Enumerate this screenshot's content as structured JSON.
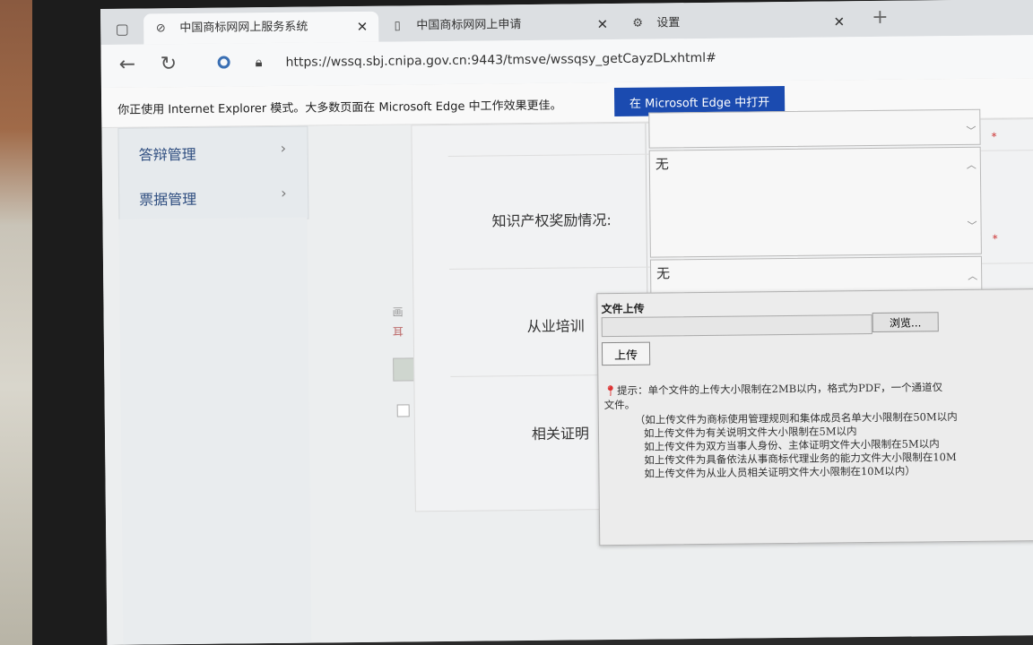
{
  "browser": {
    "tabs": [
      {
        "title": "中国商标网网上服务系统",
        "active": true
      },
      {
        "title": "中国商标网网上申请",
        "active": false
      },
      {
        "title": "设置",
        "active": false
      }
    ],
    "close_glyph": "✕",
    "new_tab_glyph": "+",
    "url": "https://wssq.sbj.cnipa.gov.cn:9443/tmsve/wssqsy_getCayzDLxhtml#"
  },
  "banner": {
    "text": "你正使用 Internet Explorer 模式。大多数页面在 Microsoft Edge 中工作效果更佳。",
    "button": "在 Microsoft Edge 中打开"
  },
  "sidebar": {
    "items": [
      {
        "label": "答辩管理"
      },
      {
        "label": "票据管理"
      }
    ]
  },
  "form": {
    "rows": [
      {
        "label": "知识产权奖励情况:",
        "value": "无"
      },
      {
        "label": "从业培训",
        "value": "无"
      },
      {
        "label": "相关证明"
      }
    ],
    "ghost_left": [
      "画",
      "耳"
    ]
  },
  "dialog": {
    "title": "文件上传",
    "browse": "浏览...",
    "upload": "上传",
    "hint": "提示：单个文件的上传大小限制在2MB以内，格式为PDF，一个通道仅",
    "hint_cont": "文件。",
    "notes": [
      "（如上传文件为商标使用管理规则和集体成员名单大小限制在50M以内",
      "如上传文件为有关说明文件大小限制在5M以内",
      "如上传文件为双方当事人身份、主体证明文件大小限制在5M以内",
      "如上传文件为具备依法从事商标代理业务的能力文件大小限制在10M",
      "如上传文件为从业人员相关证明文件大小限制在10M以内）"
    ]
  }
}
